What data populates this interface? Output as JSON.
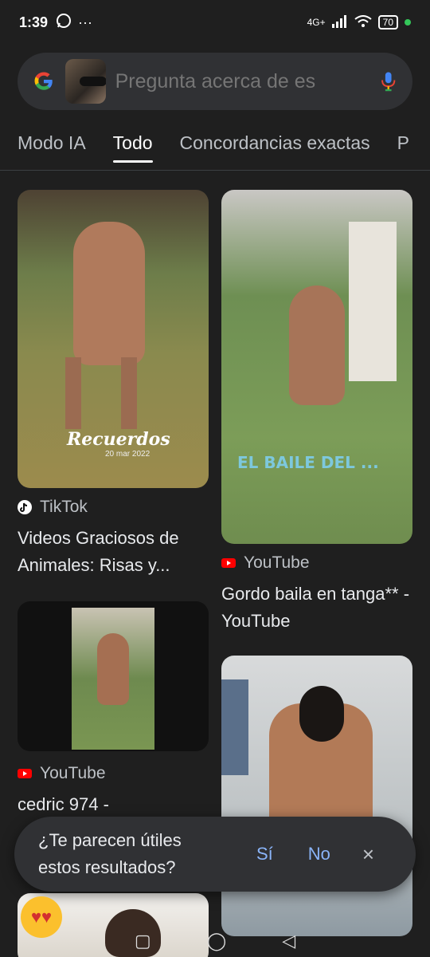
{
  "status_bar": {
    "time": "1:39",
    "network": "4G+",
    "battery": "70"
  },
  "search": {
    "placeholder": "Pregunta acerca de es"
  },
  "tabs": [
    {
      "label": "Modo IA"
    },
    {
      "label": "Todo"
    },
    {
      "label": "Concordancias exactas"
    },
    {
      "label": "P"
    }
  ],
  "results": [
    {
      "overlay": "Recuerdos",
      "overlay_sub": "20 mar 2022",
      "source": "TikTok",
      "title": "Videos Graciosos de Animales: Risas y..."
    },
    {
      "overlay": "EL BAILE DEL ...",
      "source": "YouTube",
      "title": "Gordo baila en tanga** - YouTube"
    },
    {
      "source": "YouTube",
      "title": "cedric 974 -"
    },
    {
      "source": "",
      "title": ""
    }
  ],
  "feedback": {
    "question": "¿Te parecen útiles estos resultados?",
    "yes": "Sí",
    "no": "No",
    "close": "×"
  },
  "colors": {
    "background": "#1f1f1f",
    "accent": "#8ab4f8",
    "youtube": "#ff0000"
  }
}
